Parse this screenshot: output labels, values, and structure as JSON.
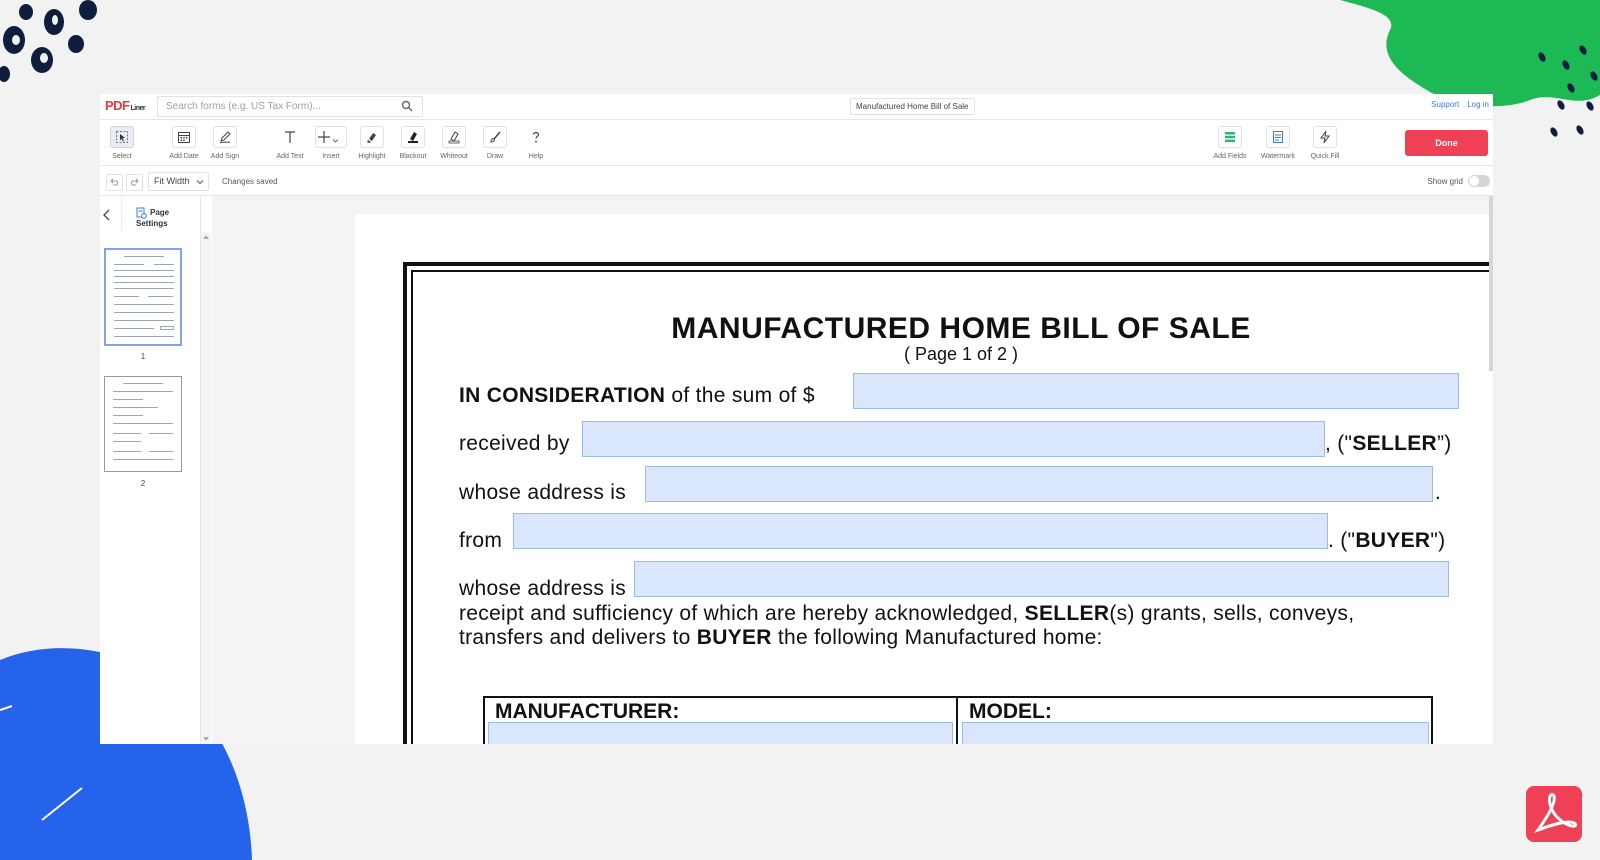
{
  "app": {
    "brand": "PDF",
    "brand_sub": "Liner",
    "search_placeholder": "Search forms (e.g. US Tax Form)...",
    "document_title": "Manufactured Home Bill of Sale",
    "links": {
      "support": "Support",
      "login": "Log in"
    }
  },
  "toolbar": {
    "tools": [
      {
        "label": "Select",
        "icon": "cursor-icon"
      },
      {
        "label": "Add Date",
        "icon": "calendar-icon"
      },
      {
        "label": "Add Sign",
        "icon": "pen-icon"
      },
      {
        "label": "Add Text",
        "icon": "text-icon"
      },
      {
        "label": "Insert",
        "icon": "plus-icon"
      },
      {
        "label": "Highlight",
        "icon": "highlighter-icon"
      },
      {
        "label": "Blackout",
        "icon": "blackout-icon"
      },
      {
        "label": "Whiteout",
        "icon": "eraser-icon"
      },
      {
        "label": "Draw",
        "icon": "brush-icon"
      },
      {
        "label": "Help",
        "icon": "question-icon"
      }
    ],
    "right_tools": [
      {
        "label": "Add Fields",
        "icon": "fields-icon"
      },
      {
        "label": "Watermark",
        "icon": "watermark-icon"
      },
      {
        "label": "Quick Fill",
        "icon": "lightning-icon"
      }
    ],
    "done_label": "Done"
  },
  "subbar": {
    "zoom": "Fit Width",
    "status": "Changes saved",
    "grid_label": "Show grid",
    "grid_on": false
  },
  "sidebar": {
    "page_settings": "Page Settings",
    "pages": [
      {
        "number": "1",
        "active": true
      },
      {
        "number": "2",
        "active": false
      }
    ]
  },
  "document": {
    "title": "MANUFACTURED HOME BILL OF SALE",
    "page_info": "( Page 1 of 2 )",
    "line1_bold": "IN CONSIDERATION",
    "line1_rest": " of the sum of $",
    "line2": "received by",
    "line2_suffix_pre": ", (\"",
    "line2_suffix_bold": "SELLER",
    "line2_suffix_post": "”)",
    "line3": "whose address is",
    "line3_suffix": ".",
    "line4": "from",
    "line4_suffix_pre": ". (\"",
    "line4_suffix_bold": "BUYER",
    "line4_suffix_post": "\")",
    "line5": "whose address is",
    "para1_pre": "receipt and sufficiency of which are hereby acknowledged, ",
    "para1_bold": "SELLER",
    "para1_post": "(s) grants, sells, conveys,",
    "para2_pre": "transfers and delivers to ",
    "para2_bold": "BUYER",
    "para2_post": " the following Manufactured home:",
    "table_headers": {
      "manufacturer": "MANUFACTURER:",
      "model": "MODEL:"
    }
  },
  "colors": {
    "accent_red": "#ee4155",
    "field_fill": "#d9e6fb",
    "link_blue": "#3d7be0",
    "deco_green": "#1db954",
    "deco_blue": "#2563eb",
    "deco_navy": "#0f1e3d"
  }
}
